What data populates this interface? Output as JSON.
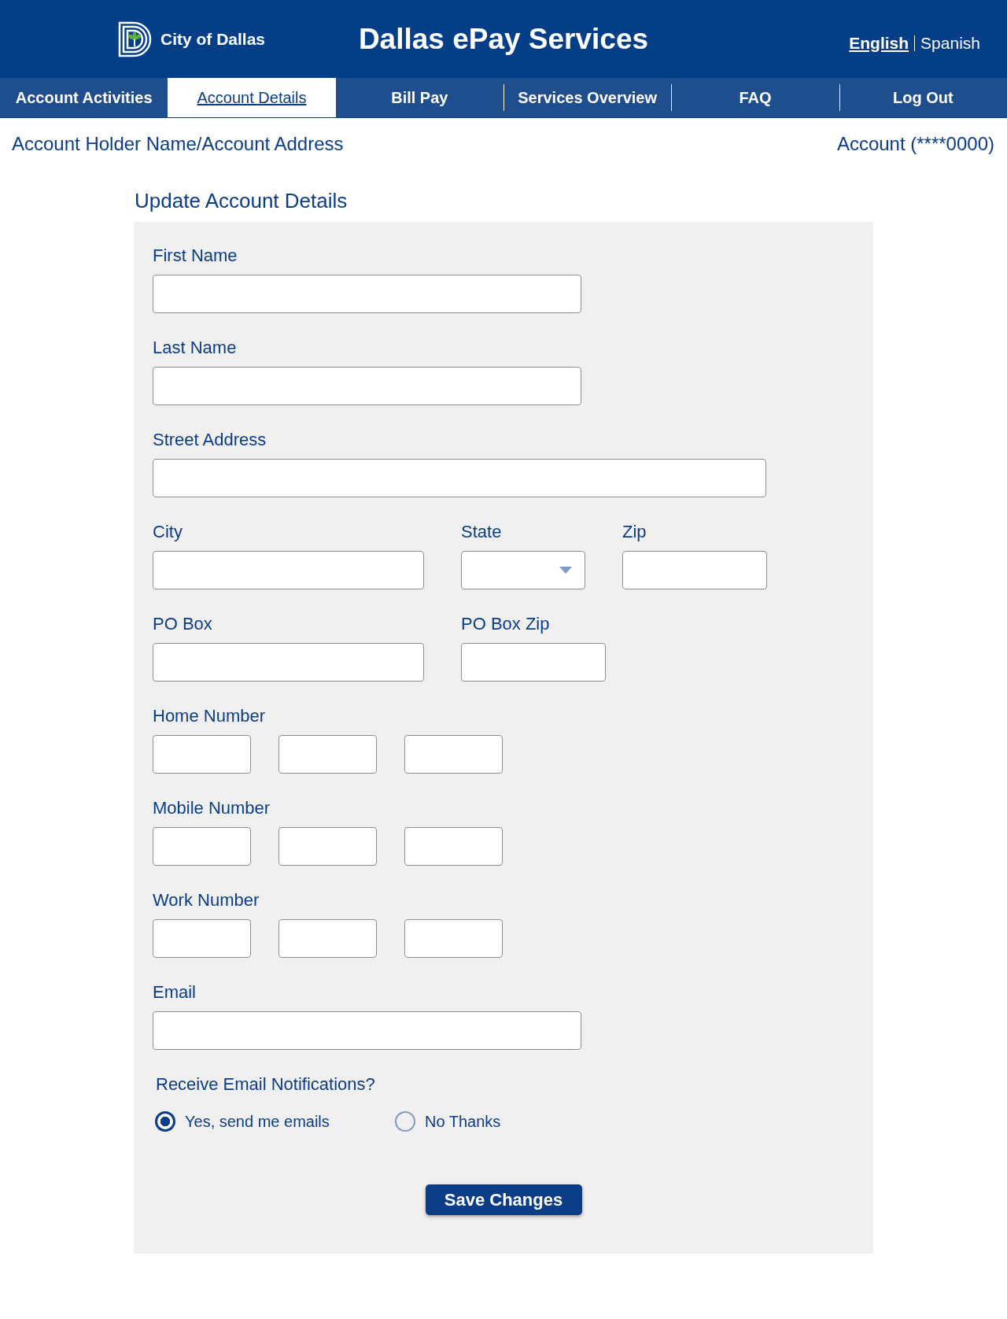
{
  "header": {
    "logo_text": "City of Dallas",
    "title": "Dallas ePay Services",
    "languages": [
      {
        "label": "English",
        "selected": true
      },
      {
        "label": "Spanish",
        "selected": false
      }
    ]
  },
  "nav": {
    "tabs": [
      {
        "label": "Account Activities",
        "selected": false
      },
      {
        "label": "Account Details",
        "selected": true
      },
      {
        "label": "Bill Pay",
        "selected": false
      },
      {
        "label": "Services Overview",
        "selected": false
      },
      {
        "label": "FAQ",
        "selected": false
      },
      {
        "label": "Log Out",
        "selected": false
      }
    ]
  },
  "account_bar": {
    "holder": "Account Holder Name/Account Address",
    "account": "Account (****0000)"
  },
  "form": {
    "title": "Update Account Details",
    "first_name": {
      "label": "First Name"
    },
    "last_name": {
      "label": "Last Name"
    },
    "street_address": {
      "label": "Street Address"
    },
    "city": {
      "label": "City"
    },
    "state": {
      "label": "State"
    },
    "zip": {
      "label": "Zip"
    },
    "po_box": {
      "label": "PO Box"
    },
    "po_box_zip": {
      "label": "PO Box Zip"
    },
    "home_number": {
      "label": "Home Number"
    },
    "mobile_number": {
      "label": "Mobile Number"
    },
    "work_number": {
      "label": "Work Number"
    },
    "email": {
      "label": "Email"
    },
    "notifications": {
      "question": "Receive Email Notifications?",
      "options": [
        {
          "label": "Yes, send me emails",
          "selected": true
        },
        {
          "label": "No Thanks",
          "selected": false
        }
      ]
    },
    "save_button": "Save Changes"
  }
}
